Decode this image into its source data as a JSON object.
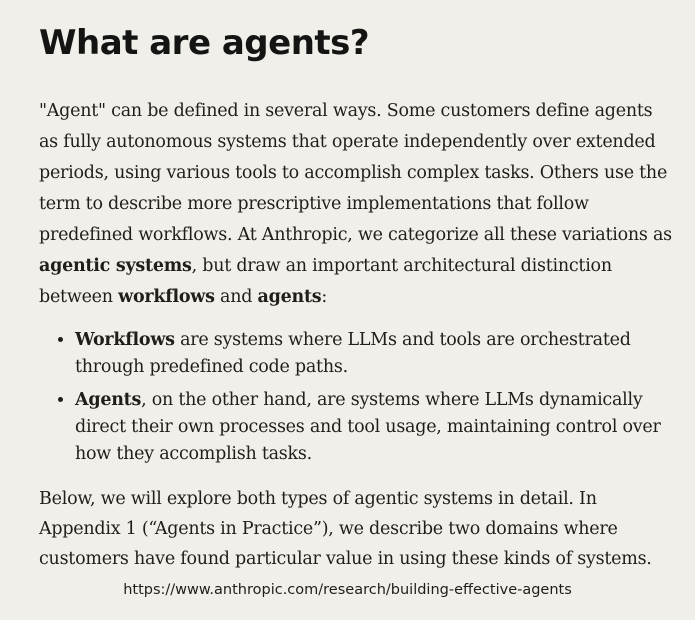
{
  "heading": "What are agents?",
  "intro": {
    "part1": "\"Agent\" can be defined in several ways. Some customers define agents as fully autonomous systems that operate independently over extended periods, using various tools to accomplish complex tasks. Others use the term to describe more prescriptive implementations that follow predefined workflows. At Anthropic, we categorize all these variations as ",
    "bold1": "agentic systems",
    "part2": ", but draw an important architectural distinction between ",
    "bold2": "workflows",
    "part3": " and ",
    "bold3": "agents",
    "part4": ":"
  },
  "list": [
    {
      "term": "Workflows",
      "text": " are systems where LLMs and tools are orchestrated through predefined code paths."
    },
    {
      "term": "Agents",
      "text": ", on the other hand, are systems where LLMs dynamically direct their own processes and tool usage, maintaining control over how they accomplish tasks."
    }
  ],
  "outro": "Below, we will explore both types of agentic systems in detail. In Appendix 1 (“Agents in Practice”), we describe two domains where customers have found particular value in using these kinds of systems.",
  "source_url": "https://www.anthropic.com/research/building-effective-agents"
}
